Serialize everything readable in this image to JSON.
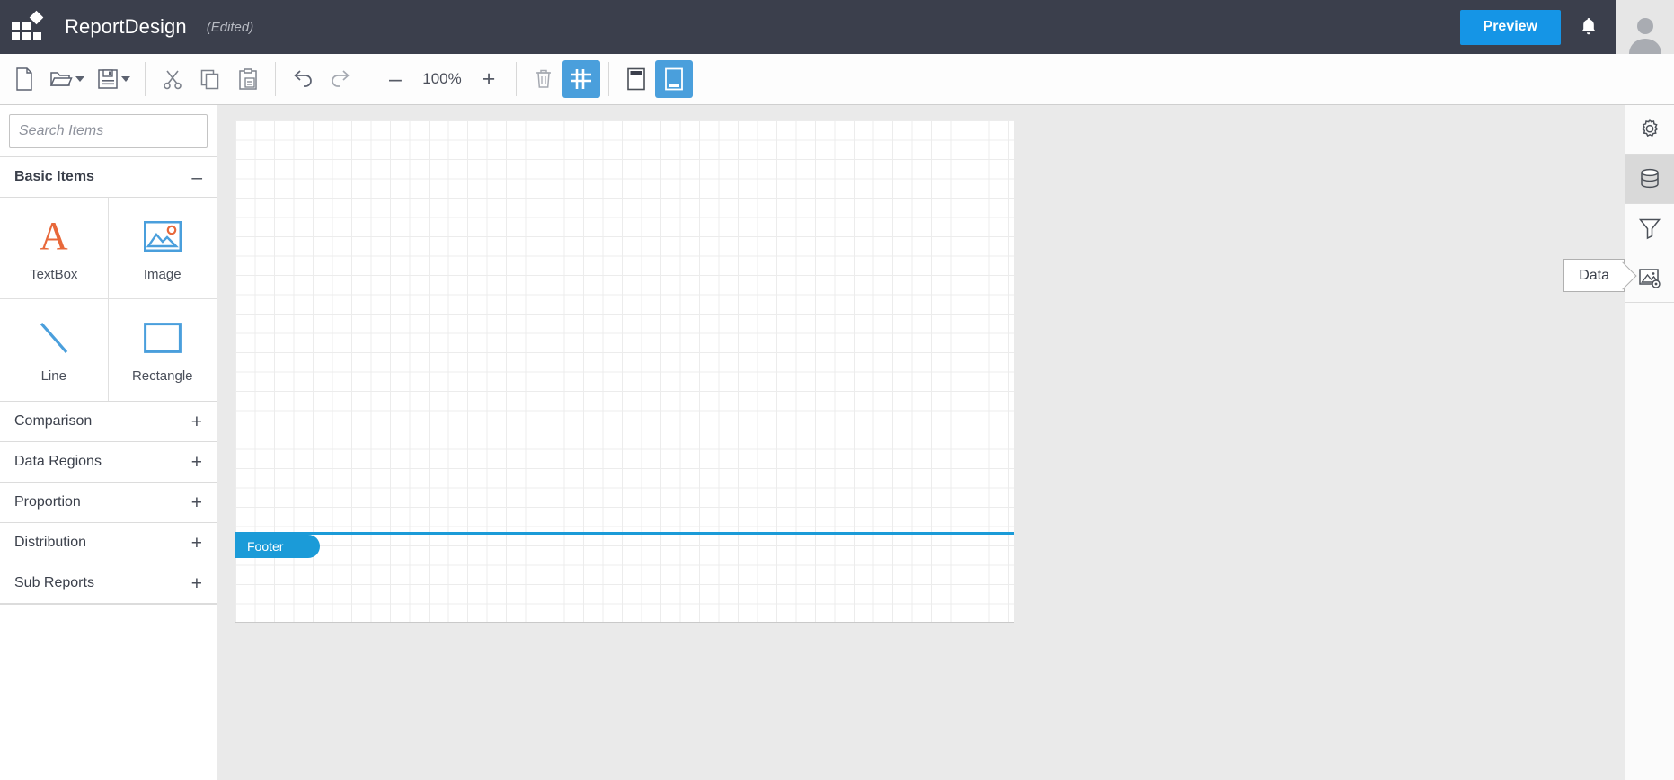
{
  "header": {
    "logo_icon": "app-grid-logo",
    "title": "ReportDesign",
    "edited_label": "(Edited)",
    "preview_label": "Preview",
    "bell_icon": "notification-bell-icon",
    "avatar_icon": "user-avatar-icon",
    "background_color": "#3b3f4c",
    "accent_color": "#1595e6"
  },
  "toolbar": {
    "new_icon": "new-document-icon",
    "open_icon": "open-folder-icon",
    "save_icon": "save-disk-icon",
    "cut_icon": "cut-scissors-icon",
    "copy_icon": "copy-icon",
    "paste_icon": "paste-icon",
    "undo_icon": "undo-arrow-icon",
    "redo_icon": "redo-arrow-icon",
    "zoom_out_label": "–",
    "zoom_value": "100%",
    "zoom_in_label": "+",
    "delete_icon": "trash-delete-icon",
    "grid_icon": "grid-toggle-icon",
    "header_panel_icon": "page-header-icon",
    "footer_panel_icon": "page-footer-icon",
    "active_color": "#4a9fdc"
  },
  "sidebar": {
    "search": {
      "placeholder": "Search Items",
      "value": "",
      "icon": "search-icon"
    },
    "basic_section": {
      "label": "Basic Items",
      "toggle": "–",
      "expanded": true
    },
    "items": [
      {
        "label": "TextBox",
        "icon": "textbox-a-icon",
        "color": "#e8683a"
      },
      {
        "label": "Image",
        "icon": "image-picture-icon",
        "color": "#4a9fdc"
      },
      {
        "label": "Line",
        "icon": "line-diagonal-icon",
        "color": "#4a9fdc"
      },
      {
        "label": "Rectangle",
        "icon": "rectangle-shape-icon",
        "color": "#4a9fdc"
      }
    ],
    "categories": [
      {
        "label": "Comparison",
        "toggle": "+"
      },
      {
        "label": "Data Regions",
        "toggle": "+"
      },
      {
        "label": "Proportion",
        "toggle": "+"
      },
      {
        "label": "Distribution",
        "toggle": "+"
      },
      {
        "label": "Sub Reports",
        "toggle": "+"
      }
    ]
  },
  "canvas": {
    "band_label": "Footer",
    "band_color": "#1b9bd8",
    "background_color": "#eaeaea"
  },
  "right_rail": {
    "tooltip_text": "Data",
    "buttons": [
      {
        "icon": "gear-settings-icon",
        "active": false
      },
      {
        "icon": "database-data-icon",
        "active": true
      },
      {
        "icon": "filter-funnel-icon",
        "active": false
      },
      {
        "icon": "image-settings-icon",
        "active": false
      }
    ]
  }
}
